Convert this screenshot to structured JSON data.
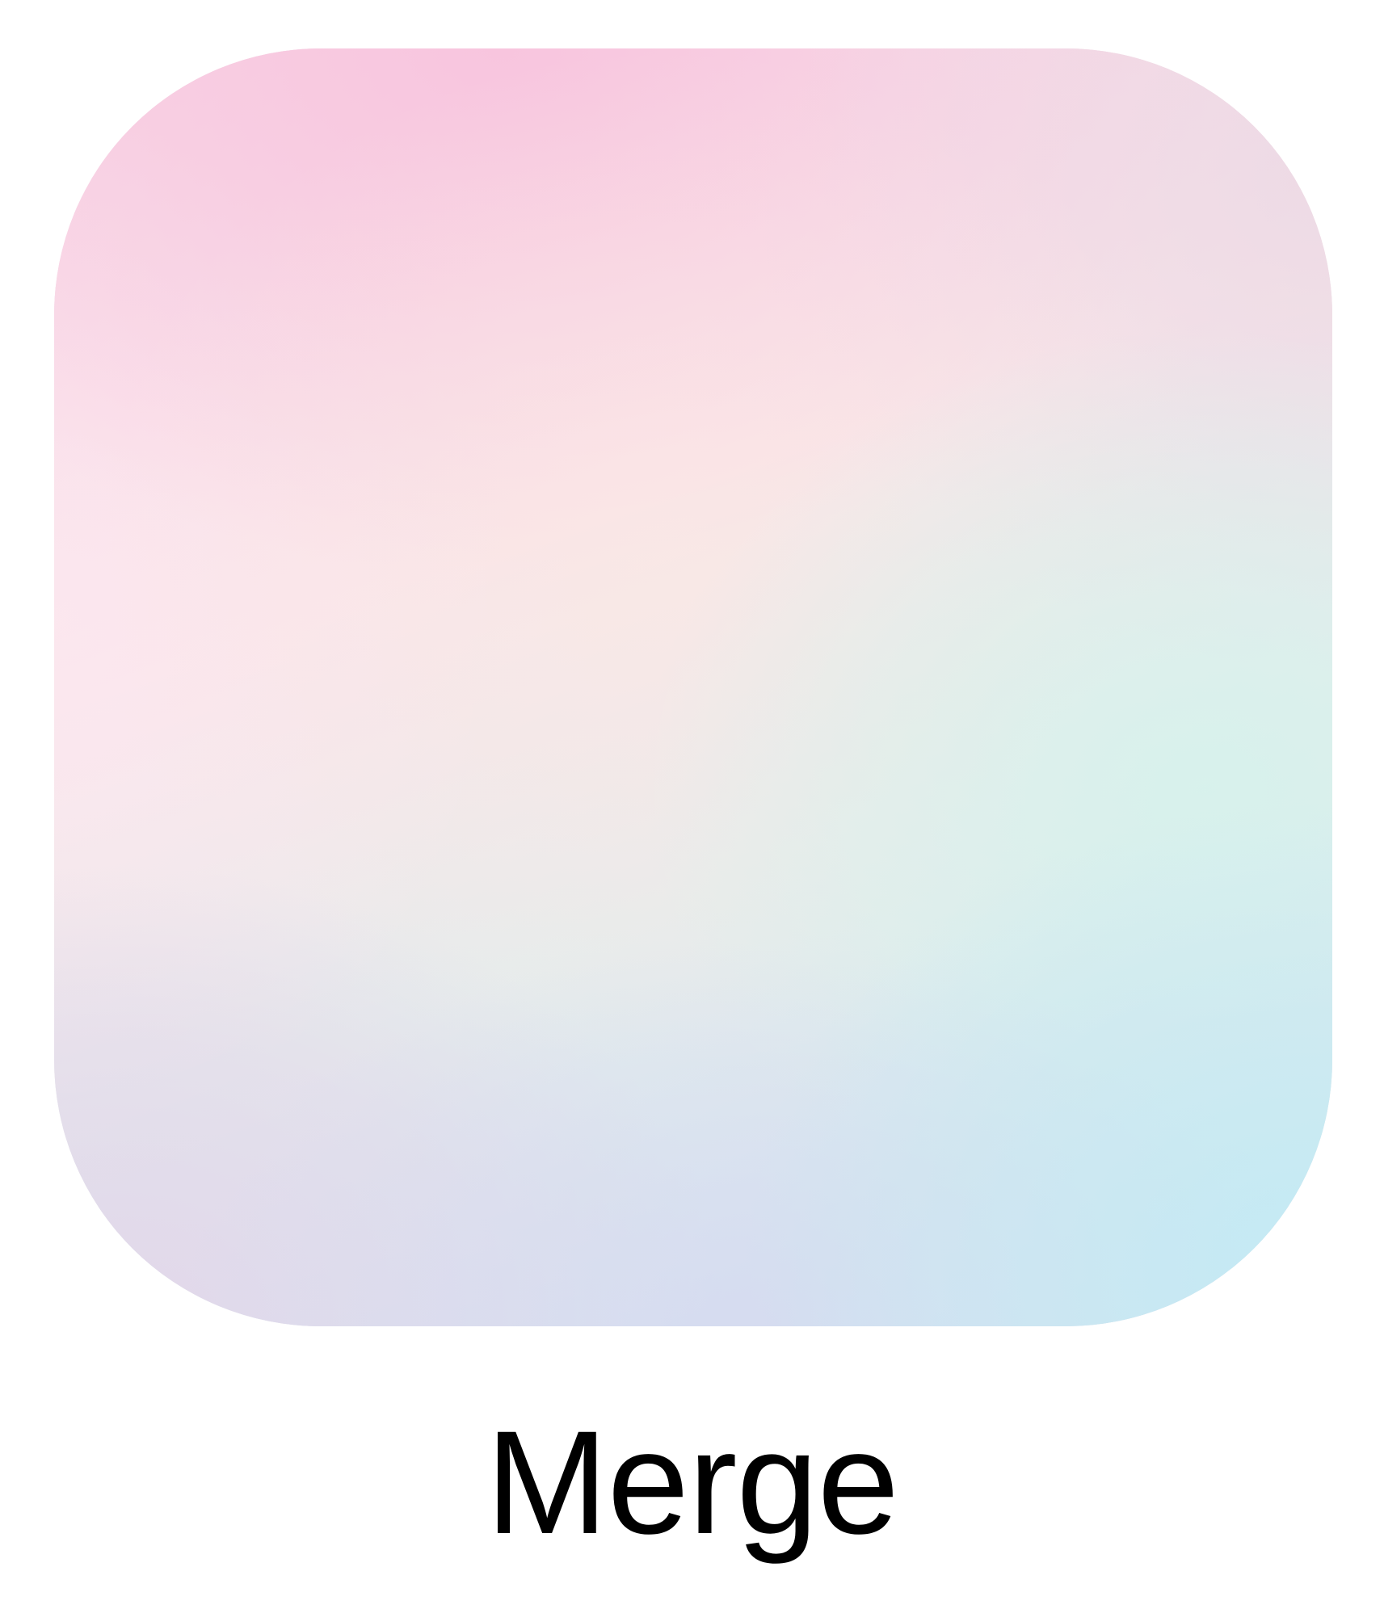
{
  "app": {
    "name": "Merge",
    "icon_name": "merge-app-icon",
    "label_color": "#000000",
    "icon_colors": [
      "#f8cfe3",
      "#f9e5ea",
      "#e6ecec",
      "#d6f2ec",
      "#c4eaf4",
      "#e2d6ea",
      "#d6daf0"
    ]
  }
}
